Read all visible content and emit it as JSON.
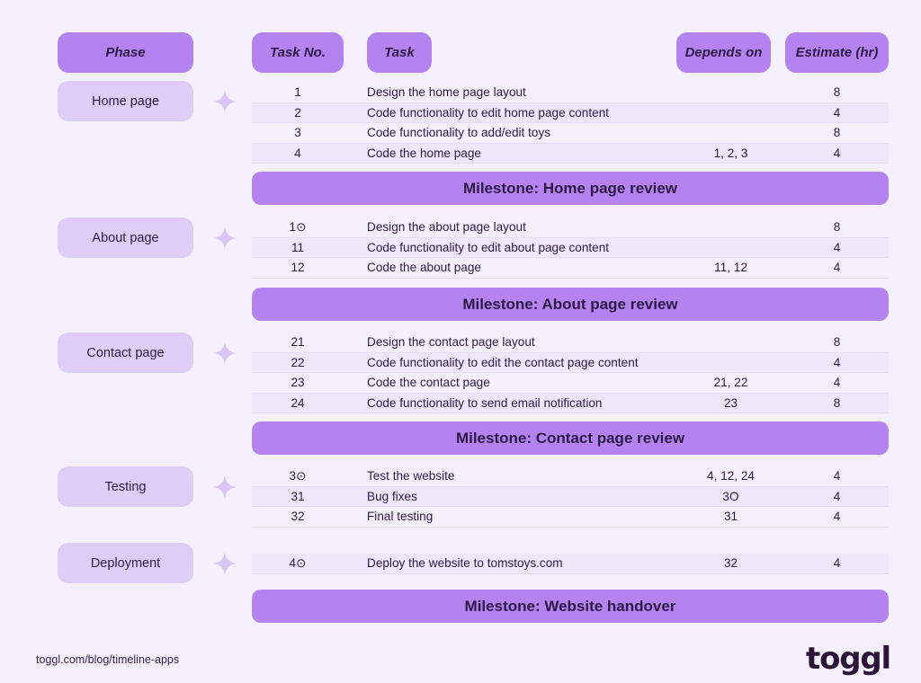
{
  "theme": {
    "background": "#f5f0fe",
    "chip_header_bg": "#b483f0",
    "chip_phase_bg": "#ddcdf7",
    "milestone_bg": "#b483f0",
    "row_alt_bg": "#efe8fc",
    "text_color": "#2e1a47",
    "sparkle_color": "#d9c6f6",
    "logo_color": "#2c1338"
  },
  "headers": {
    "phase": "Phase",
    "task_no": "Task No.",
    "task": "Task",
    "depends_on": "Depends on",
    "estimate": "Estimate (hr)"
  },
  "phases": [
    {
      "label": "Home page"
    },
    {
      "label": "About page"
    },
    {
      "label": "Contact page"
    },
    {
      "label": "Testing"
    },
    {
      "label": "Deployment"
    }
  ],
  "groups": [
    {
      "phase": "Home page",
      "rows": [
        {
          "no": "1",
          "task": "Design the home page layout",
          "depends": "",
          "estimate": "8"
        },
        {
          "no": "2",
          "task": "Code functionality to edit home page content",
          "depends": "",
          "estimate": "4"
        },
        {
          "no": "3",
          "task": "Code functionality to add/edit toys",
          "depends": "",
          "estimate": "8"
        },
        {
          "no": "4",
          "task": "Code the home page",
          "depends": "1, 2, 3",
          "estimate": "4"
        }
      ],
      "milestone": "Milestone: Home page review"
    },
    {
      "phase": "About page",
      "rows": [
        {
          "no": "1⊙",
          "task": "Design the about page layout",
          "depends": "",
          "estimate": "8"
        },
        {
          "no": "11",
          "task": "Code functionality to edit about page content",
          "depends": "",
          "estimate": "4"
        },
        {
          "no": "12",
          "task": "Code the about page",
          "depends": "11, 12",
          "estimate": "4"
        }
      ],
      "milestone": "Milestone: About page review"
    },
    {
      "phase": "Contact page",
      "rows": [
        {
          "no": "21",
          "task": "Design the contact page layout",
          "depends": "",
          "estimate": "8"
        },
        {
          "no": "22",
          "task": "Code functionality to edit the contact page content",
          "depends": "",
          "estimate": "4"
        },
        {
          "no": "23",
          "task": "Code the contact page",
          "depends": "21, 22",
          "estimate": "4"
        },
        {
          "no": "24",
          "task": "Code functionality to send email notification",
          "depends": "23",
          "estimate": "8"
        }
      ],
      "milestone": "Milestone: Contact page review"
    },
    {
      "phase": "Testing",
      "rows": [
        {
          "no": "3⊙",
          "task": "Test the website",
          "depends": "4, 12, 24",
          "estimate": "4"
        },
        {
          "no": "31",
          "task": "Bug fixes",
          "depends": "3O",
          "estimate": "4"
        },
        {
          "no": "32",
          "task": "Final testing",
          "depends": "31",
          "estimate": "4"
        }
      ],
      "milestone": ""
    },
    {
      "phase": "Deployment",
      "rows": [
        {
          "no": "4⊙",
          "task": "Deploy the website to tomstoys.com",
          "depends": "32",
          "estimate": "4"
        }
      ],
      "milestone": "Milestone: Website handover"
    }
  ],
  "footer": {
    "url": "toggl.com/blog/timeline-apps",
    "logo": "toggl"
  }
}
